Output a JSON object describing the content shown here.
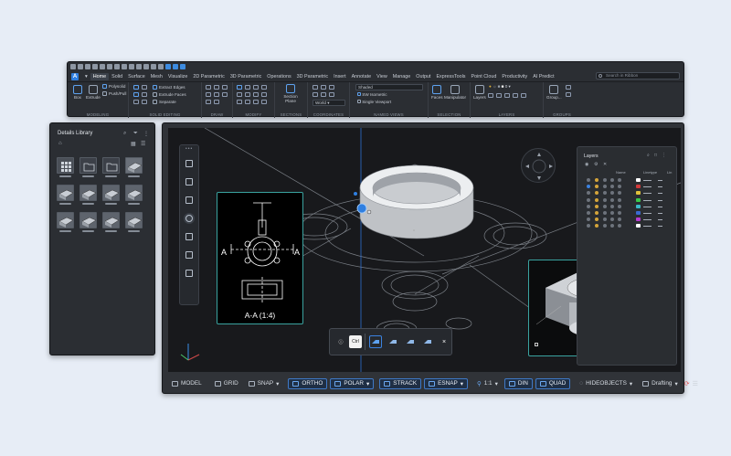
{
  "ribbon": {
    "tabs": [
      "Home",
      "Solid",
      "Surface",
      "Mesh",
      "Visualize",
      "2D Parametric",
      "3D Parametric",
      "Operations",
      "3D Parametric",
      "Insert",
      "Annotate",
      "View",
      "Manage",
      "Output",
      "ExpressTools",
      "Point Cloud",
      "Productivity",
      "AI Predict"
    ],
    "search_placeholder": "Search in Ribbon",
    "panels": {
      "modeling": {
        "title": "MODELING",
        "box": "Box",
        "extrude": "Extrude",
        "polysolid": "Polysolid",
        "pushpull": "Push/Pull"
      },
      "solid_editing": {
        "title": "SOLID EDITING",
        "extract_edges": "Extract Edges",
        "extrude_faces": "Extrude Faces",
        "separate": "Separate"
      },
      "draw": {
        "title": "DRAW"
      },
      "modify": {
        "title": "MODIFY"
      },
      "sections": {
        "title": "SECTIONS",
        "section_plane": "Section Plane"
      },
      "coordinates": {
        "title": "COORDINATES",
        "world": "World"
      },
      "named_views": {
        "title": "NAMED VIEWS",
        "visual_style": "Shaded",
        "view": "SW Isometric",
        "viewport": "Single Viewport"
      },
      "selection": {
        "title": "SELECTION",
        "faces": "Faces",
        "manipulator": "Manipulator"
      },
      "layers": {
        "title": "LAYERS",
        "layers": "Layers",
        "layer_value": "0"
      },
      "groups": {
        "title": "GROUPS",
        "group": "Group..."
      }
    }
  },
  "library": {
    "title": "Details Library"
  },
  "viewport": {
    "section_label": "A-A (1:4)",
    "marker_left": "A",
    "marker_right": "A",
    "ctrl_label": "Ctrl",
    "layers_panel": {
      "title": "Layers",
      "columns": [
        "Name",
        "Linetype",
        "Lin"
      ]
    }
  },
  "statusbar": {
    "model": "MODEL",
    "grid": "GRID",
    "snap": "SNAP",
    "ortho": "ORTHO",
    "polar": "POLAR",
    "strack": "STRACK",
    "esnap": "ESNAP",
    "scale": "1:1",
    "din": "DIN",
    "quad": "QUAD",
    "hideobjects": "HIDEOBJECTS",
    "workspace": "Drafting"
  },
  "colors": {
    "accent": "#3b82e0",
    "teal_frame": "#3aa3a0",
    "layer_colors": [
      "#ffffff",
      "#d13a3a",
      "#e0c13a",
      "#3ac84a",
      "#3ab9c8",
      "#3a6ad1",
      "#b83ad1",
      "#ffffff"
    ]
  }
}
